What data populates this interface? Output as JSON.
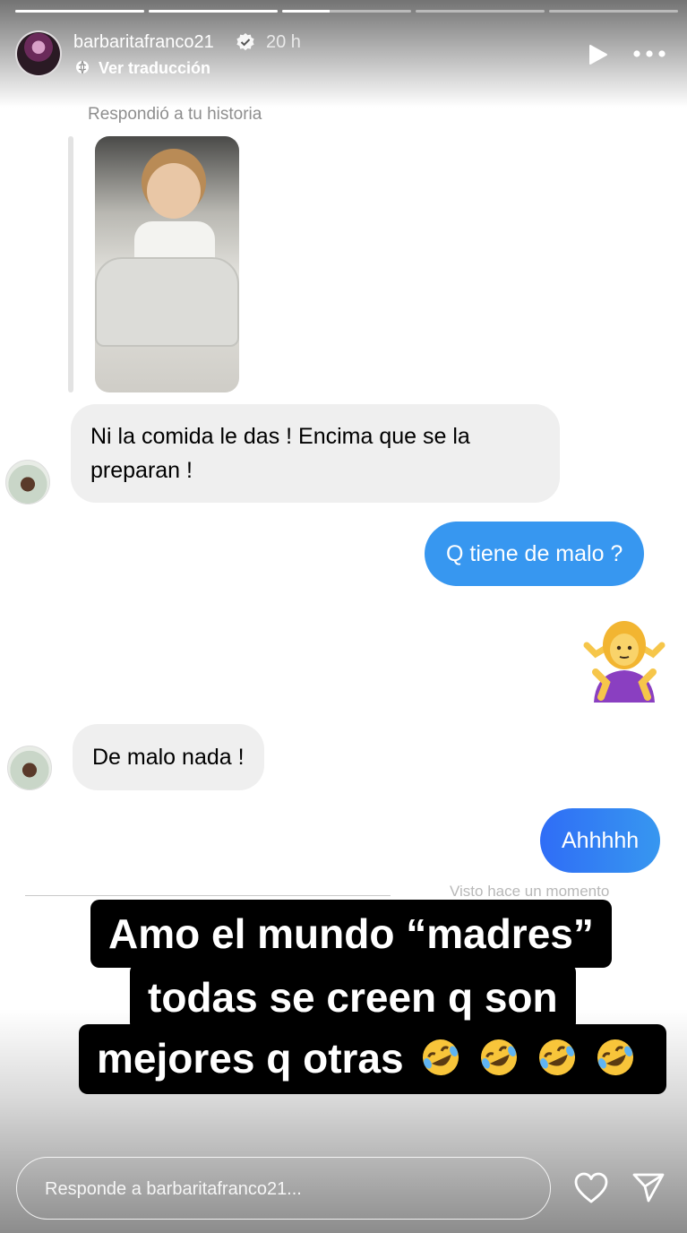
{
  "header": {
    "username": "barbaritafranco21",
    "time_ago": "20 h",
    "translate_label": "Ver traducción",
    "progress": {
      "total_segments": 5,
      "current_segment": 3,
      "current_fraction": 0.37
    }
  },
  "chat": {
    "reply_label": "Respondió a tu historia",
    "messages": [
      {
        "side": "in",
        "text_line1": "Ni la comida le das ! Encima que se la",
        "text_line2": "preparan !"
      },
      {
        "side": "out",
        "text": "Q tiene de malo ?"
      },
      {
        "side": "out",
        "emoji": "woman-shrugging"
      },
      {
        "side": "in",
        "text": "De malo nada !"
      },
      {
        "side": "out",
        "text": "Ahhhhh"
      }
    ],
    "seen_text": "Visto hace un momento"
  },
  "caption": {
    "line1": "Amo el mundo “madres”",
    "line2": "todas se creen q son",
    "line3": "mejores q otras",
    "emojis": [
      "rolling-on-floor-laughing",
      "rolling-on-floor-laughing",
      "rolling-on-floor-laughing",
      "rolling-on-floor-laughing"
    ]
  },
  "footer": {
    "reply_placeholder": "Responde a barbaritafranco21..."
  },
  "colors": {
    "outgoing_bubble": "#3797f0",
    "incoming_bubble": "#efefef",
    "caption_bg": "#000000"
  }
}
